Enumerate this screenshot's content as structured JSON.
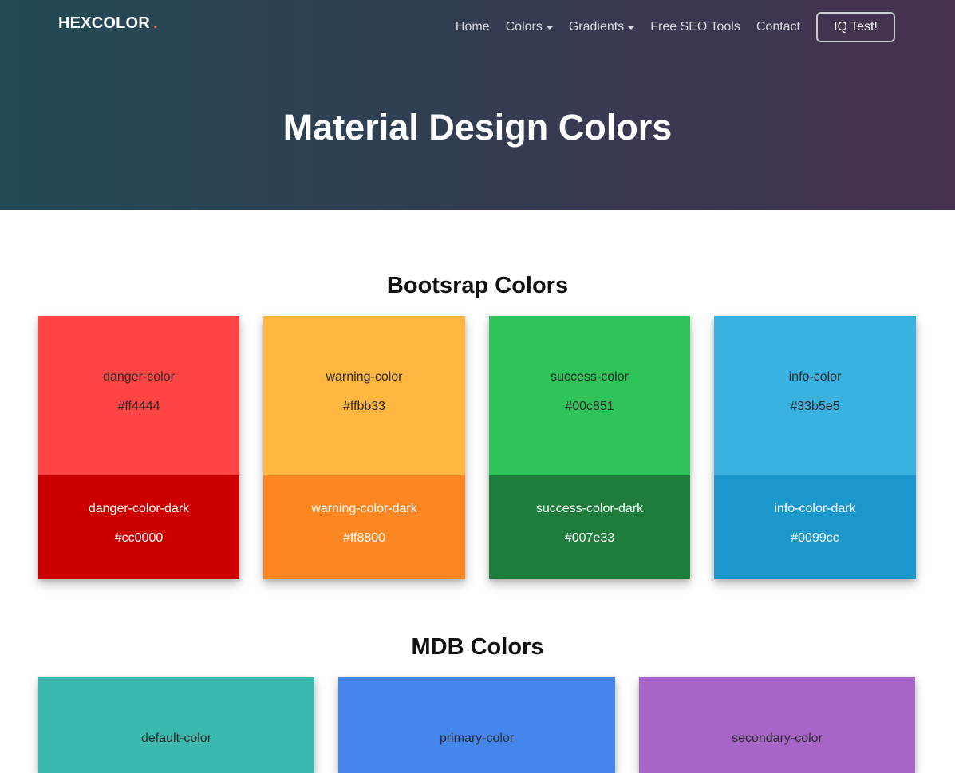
{
  "header": {
    "brand": "HEXCOLOR",
    "brand_dot": ".",
    "nav": [
      {
        "label": "Home",
        "dropdown": false
      },
      {
        "label": "Colors",
        "dropdown": true
      },
      {
        "label": "Gradients",
        "dropdown": true
      },
      {
        "label": "Free SEO Tools",
        "dropdown": false
      },
      {
        "label": "Contact",
        "dropdown": false
      }
    ],
    "cta": "IQ Test!",
    "title": "Material Design Colors"
  },
  "bootstrap": {
    "title": "Bootsrap Colors",
    "cards": [
      {
        "name": "danger-color",
        "hex": "#ff4444",
        "dark_name": "danger-color-dark",
        "dark_hex": "#cc0000",
        "color": "#ff4444",
        "dark_color": "#cc0000"
      },
      {
        "name": "warning-color",
        "hex": "#ffbb33",
        "dark_name": "warning-color-dark",
        "dark_hex": "#ff8800",
        "color": "#ffb742",
        "dark_color": "#fc8622"
      },
      {
        "name": "success-color",
        "hex": "#00c851",
        "dark_name": "success-color-dark",
        "dark_hex": "#007e33",
        "color": "#2fc45a",
        "dark_color": "#1e7d3d"
      },
      {
        "name": "info-color",
        "hex": "#33b5e5",
        "dark_name": "info-color-dark",
        "dark_hex": "#0099cc",
        "color": "#3ab2e1",
        "dark_color": "#1b97cc"
      }
    ]
  },
  "mdb": {
    "title": "MDB Colors",
    "cards": [
      {
        "name": "default-color",
        "color": "#3bb9ae"
      },
      {
        "name": "primary-color",
        "color": "#4586ec"
      },
      {
        "name": "secondary-color",
        "color": "#a765c8"
      }
    ]
  }
}
